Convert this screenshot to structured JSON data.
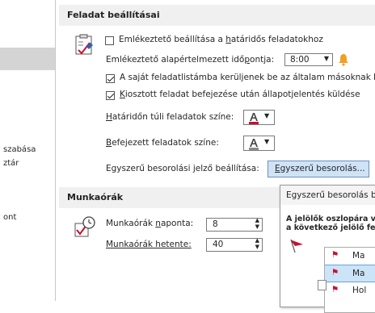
{
  "nav": {
    "items": [
      "szabása",
      "ztár",
      "ont"
    ]
  },
  "tasks": {
    "section_title": "Feladat beállításai",
    "reminder_checkbox": {
      "label_prefix": "Emlékeztető beállítása a ",
      "label_accel": "h",
      "label_suffix": "atáridős feladatokhoz",
      "checked": false
    },
    "default_time": {
      "label_prefix": "Emlékeztető alapértelmezett idő",
      "label_accel": "p",
      "label_suffix": "ontja:",
      "value": "8:00"
    },
    "keep_list_checkbox": {
      "label": "A saját feladatlistámba kerüljenek be az általam másoknak k",
      "checked": true
    },
    "status_report_checkbox": {
      "label_accel": "K",
      "label_suffix": "iosztott feladat befejezése után állapotjelentés küldése",
      "checked": true
    },
    "overdue_color": {
      "label_accel": "H",
      "label_suffix": "atáridőn túli feladatok színe:"
    },
    "completed_color": {
      "label_accel": "B",
      "label_suffix": "efejezett feladatok színe:"
    },
    "quick_click": {
      "label": "Egyszerű besorolási jelző beállítása:",
      "button_accel": "E",
      "button_suffix": "gyszerű besorolás..."
    }
  },
  "work_hours": {
    "section_title": "Munkaórák",
    "daily": {
      "label_prefix": "Munkaórák ",
      "label_accel": "n",
      "label_suffix": "aponta:",
      "value": "8"
    },
    "weekly": {
      "label_prefix": "Munkaórák hetente:",
      "value": "40"
    }
  },
  "popup": {
    "title": "Egyszerű besorolás b",
    "desc_line1": "A jelölők oszlopára va",
    "desc_line2": "a következő jelölő fel",
    "options": [
      "Ma",
      "Ma",
      "Hol"
    ]
  },
  "colors": {
    "flag_red": "#c8102e",
    "selection_blue": "#cce4f7",
    "bell_orange": "#f0a020"
  }
}
